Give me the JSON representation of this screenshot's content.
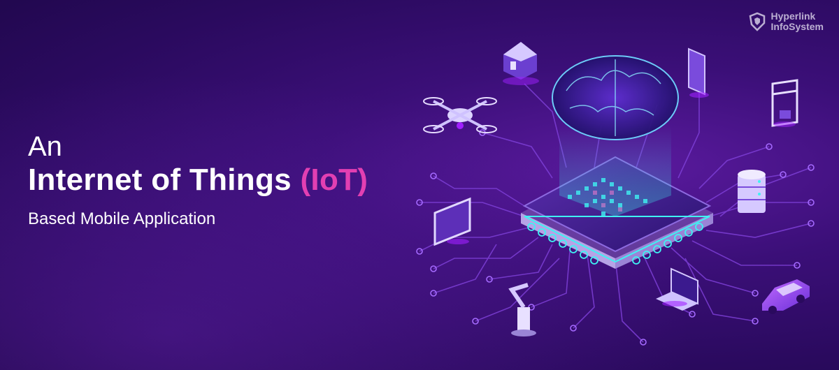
{
  "headline": {
    "line1": "An",
    "line2_main": "Internet of Things",
    "line2_accent": "(IoT)",
    "line3": "Based Mobile Application"
  },
  "brand": {
    "line1": "Hyperlink",
    "line2": "InfoSystem"
  },
  "colors": {
    "background": "#2a0a5e",
    "accent": "#e23fb2",
    "circuit": "#7d3fd6",
    "glow": "#3ff2f2"
  },
  "illustration": {
    "items": [
      "house-icon",
      "drone-icon",
      "brain-icon",
      "smartphone-icon",
      "3d-printer-icon",
      "microchip-icon",
      "server-database-icon",
      "monitor-icon",
      "robotic-arm-icon",
      "laptop-icon",
      "car-icon"
    ]
  }
}
